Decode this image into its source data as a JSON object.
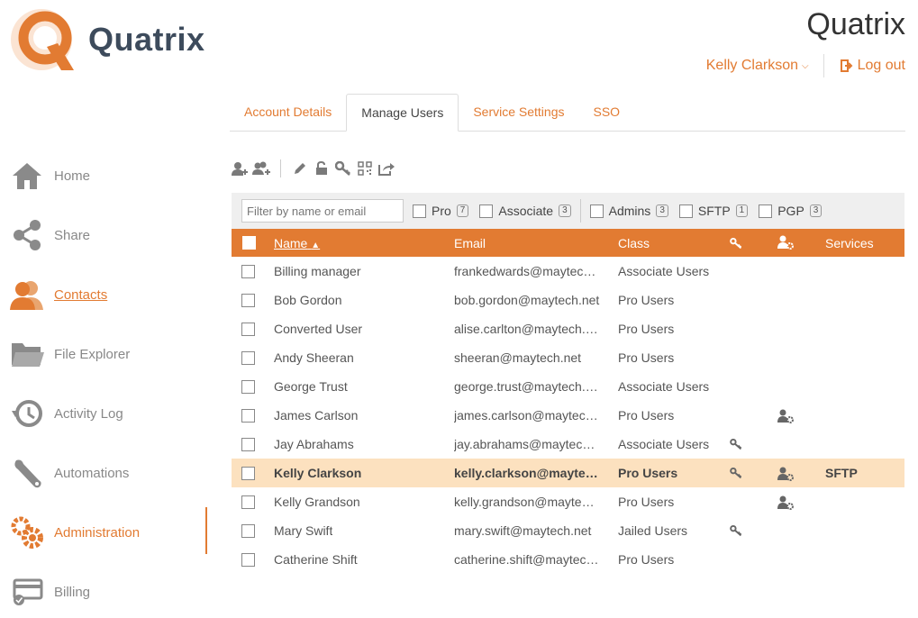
{
  "brand": {
    "logo_text": "Quatrix",
    "title": "Quatrix"
  },
  "user": {
    "name": "Kelly Clarkson",
    "logout": "Log out"
  },
  "tabs": [
    {
      "label": "Account Details"
    },
    {
      "label": "Manage Users"
    },
    {
      "label": "Service Settings"
    },
    {
      "label": "SSO"
    }
  ],
  "nav": [
    {
      "label": "Home",
      "icon": "home-icon"
    },
    {
      "label": "Share",
      "icon": "share-icon"
    },
    {
      "label": "Contacts",
      "icon": "contacts-icon"
    },
    {
      "label": "File Explorer",
      "icon": "folder-icon"
    },
    {
      "label": "Activity Log",
      "icon": "history-icon"
    },
    {
      "label": "Automations",
      "icon": "wrench-icon"
    },
    {
      "label": "Administration",
      "icon": "gears-icon"
    },
    {
      "label": "Billing",
      "icon": "billing-icon"
    }
  ],
  "filter": {
    "placeholder": "Filter by name or email",
    "options": [
      {
        "label": "Pro",
        "count": "7"
      },
      {
        "label": "Associate",
        "count": "3"
      },
      {
        "label": "Admins",
        "count": "3"
      },
      {
        "label": "SFTP",
        "count": "1"
      },
      {
        "label": "PGP",
        "count": "3"
      }
    ]
  },
  "table": {
    "headers": {
      "name": "Name",
      "email": "Email",
      "class": "Class",
      "services": "Services"
    },
    "rows": [
      {
        "name": "Billing manager",
        "email": "frankedwards@maytech.net",
        "class": "Associate Users",
        "key": false,
        "admin": false,
        "services": ""
      },
      {
        "name": "Bob Gordon",
        "email": "bob.gordon@maytech.net",
        "class": "Pro Users",
        "key": false,
        "admin": false,
        "services": ""
      },
      {
        "name": "Converted User",
        "email": "alise.carlton@maytech.net",
        "class": "Pro Users",
        "key": false,
        "admin": false,
        "services": ""
      },
      {
        "name": "Andy Sheeran",
        "email": "sheeran@maytech.net",
        "class": "Pro Users",
        "key": false,
        "admin": false,
        "services": ""
      },
      {
        "name": "George Trust",
        "email": "george.trust@maytech.net",
        "class": "Associate Users",
        "key": false,
        "admin": false,
        "services": ""
      },
      {
        "name": "James Carlson",
        "email": "james.carlson@maytech.net",
        "class": "Pro Users",
        "key": false,
        "admin": true,
        "services": ""
      },
      {
        "name": "Jay Abrahams",
        "email": "jay.abrahams@maytech.net",
        "class": "Associate Users",
        "key": true,
        "admin": false,
        "services": ""
      },
      {
        "name": "Kelly Clarkson",
        "email": "kelly.clarkson@maytech.net",
        "class": "Pro Users",
        "key": true,
        "admin": true,
        "services": "SFTP",
        "selected": true
      },
      {
        "name": "Kelly Grandson",
        "email": "kelly.grandson@maytech.net",
        "class": "Pro Users",
        "key": false,
        "admin": true,
        "services": ""
      },
      {
        "name": "Mary Swift",
        "email": "mary.swift@maytech.net",
        "class": "Jailed Users",
        "key": true,
        "admin": false,
        "services": ""
      },
      {
        "name": "Catherine Shift",
        "email": "catherine.shift@maytech.net",
        "class": "Pro Users",
        "key": false,
        "admin": false,
        "services": ""
      }
    ]
  },
  "colors": {
    "accent": "#e27b32",
    "selected_row": "#fce1bf",
    "header_text": "#3d4b5c"
  }
}
